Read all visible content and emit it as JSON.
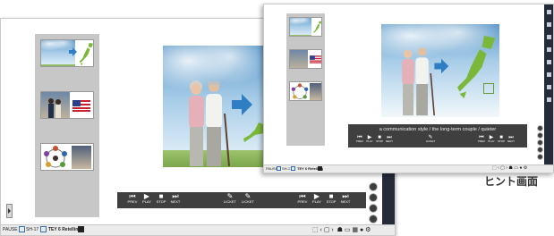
{
  "back_window": {
    "bottom_controls_left": [
      {
        "glyph": "⏮",
        "label": "PREV"
      },
      {
        "glyph": "▶",
        "label": "PLAY"
      },
      {
        "glyph": "■",
        "label": "STOP"
      },
      {
        "glyph": "⏭",
        "label": "NEXT"
      }
    ],
    "bottom_controls_mid": [
      {
        "glyph": "✎",
        "label": "LICKET"
      },
      {
        "glyph": "✎",
        "label": "LICKET"
      }
    ],
    "bottom_controls_right": [
      {
        "glyph": "⏮",
        "label": "PREV"
      },
      {
        "glyph": "▶",
        "label": "PLAY"
      },
      {
        "glyph": "■",
        "label": "STOP"
      },
      {
        "glyph": "⏭",
        "label": "NEXT"
      }
    ],
    "statusbar": {
      "left_label": "PAUSE",
      "tab1": "SH-17",
      "tab2": "TEY 6 Retelling"
    }
  },
  "front_window": {
    "caption": "a communication style / the long-term couple / quieter",
    "bottom_controls_left": [
      {
        "glyph": "⏮",
        "label": "PREV"
      },
      {
        "glyph": "▶",
        "label": "PLAY"
      },
      {
        "glyph": "■",
        "label": "STOP"
      },
      {
        "glyph": "⏭",
        "label": "NEXT"
      }
    ],
    "bottom_controls_mid": [
      {
        "glyph": "✎",
        "label": "LICKET"
      }
    ],
    "bottom_controls_right": [
      {
        "glyph": "⏮",
        "label": "PREV"
      },
      {
        "glyph": "▶",
        "label": "PLAY"
      },
      {
        "glyph": "■",
        "label": "STOP"
      },
      {
        "glyph": "⏭",
        "label": "NEXT"
      }
    ],
    "statusbar": {
      "left_label": "PAUSE",
      "tab1": "SH-17",
      "tab2": "TEY 6 Retelling"
    }
  },
  "hint_label": "ヒント画面",
  "colors": {
    "accent_arrow": "#2f7ec4",
    "japan_map": "#7bb83a",
    "caption_bg": "#3f3f3f",
    "dark_sidebar": "#262b3a"
  },
  "icons": [
    "arrow-right-icon",
    "japan-map-icon",
    "us-flag-icon",
    "pen-icon",
    "settings-icon",
    "home-icon"
  ]
}
